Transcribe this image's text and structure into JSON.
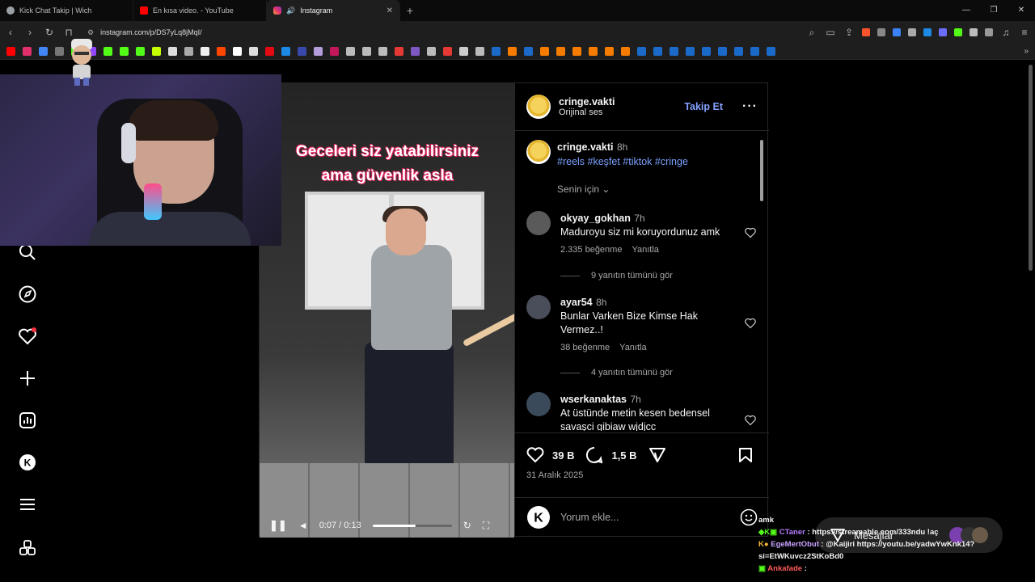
{
  "browser": {
    "tabs": [
      {
        "title": "Kick Chat Takip | Wich",
        "icon_color": "#9aa0a6",
        "active": false
      },
      {
        "title": "En kısa video. - YouTube",
        "icon_color": "#ff0000",
        "active": false
      },
      {
        "title": "Instagram",
        "icon_color": "#e1306c",
        "active": true,
        "audio": true
      }
    ],
    "url": "instagram.com/p/DS7yLq8jMqI/"
  },
  "post": {
    "author": "cringe.vakti",
    "audio": "Orijinal ses",
    "follow_label": "Takip Et",
    "video_caption_line1": "Geceleri siz yatabilirsiniz",
    "video_caption_line2": "ama güvenlik asla",
    "video_time": "0:07 / 0:13",
    "video_progress": 0.54,
    "caption_time": "8h",
    "hashtags": "#reels #keşfet #tiktok #cringe",
    "sort_label": "Senin için",
    "comments": [
      {
        "user": "okyay_gokhan",
        "time": "7h",
        "text": "Maduroyu siz mi koruyordunuz amk",
        "likes": "2.335 beğenme",
        "reply": "Yanıtla",
        "replies": "9 yanıtın tümünü gör"
      },
      {
        "user": "ayar54",
        "time": "8h",
        "text": "Bunlar Varken Bize Kimse Hak Vermez..!",
        "likes": "38 beğenme",
        "reply": "Yanıtla",
        "replies": "4 yanıtın tümünü gör"
      },
      {
        "user": "wserkanaktas",
        "time": "7h",
        "text": "At üstünde metin kesen bedensel savaşci gibiaw wjdjcc"
      }
    ],
    "like_count": "39 B",
    "comment_count": "1,5 B",
    "date": "31 Aralık 2025",
    "add_comment_placeholder": "Yorum ekle..."
  },
  "chat": {
    "lines": [
      {
        "user": "",
        "text": "amk"
      },
      {
        "user": "CTaner",
        "user_color": "#b57cff",
        "text": ": https://streamable.com/333ndu !aç"
      },
      {
        "user": "EgeMertObut",
        "user_color": "#c9a2ff",
        "text": ": @Kaijiri https://youtu.be/yadwYwKnk14?si=EtWKuvcz2StKoBd0"
      },
      {
        "user": "Ankafade",
        "user_color": "#ff5b5b",
        "text": ":"
      }
    ],
    "message_label": "Mesajlar"
  }
}
